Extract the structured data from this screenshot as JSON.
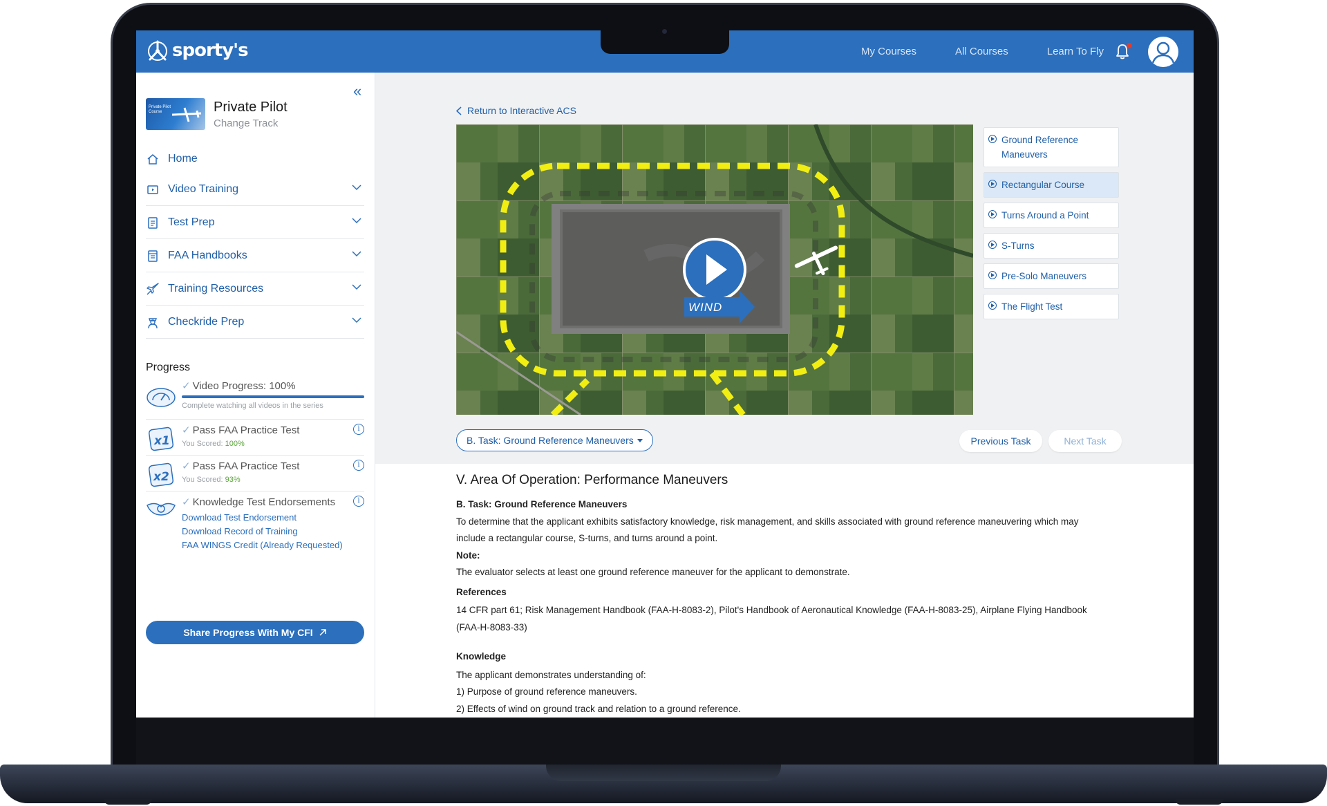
{
  "header": {
    "logo_text": "sporty's",
    "nav": [
      "My Courses",
      "All Courses",
      "Learn To Fly"
    ],
    "icons": [
      "bell-icon",
      "user-avatar-icon"
    ],
    "notification_dot_color": "#e23a2b"
  },
  "sidebar": {
    "course_thumb_text": "Private Pilot Course",
    "course_title": "Private Pilot",
    "course_subtitle": "Change Track",
    "items": [
      {
        "label": "Home",
        "icon": "home-icon"
      },
      {
        "label": "Video Training",
        "icon": "video-icon"
      },
      {
        "label": "Test Prep",
        "icon": "clipboard-icon"
      },
      {
        "label": "FAA Handbooks",
        "icon": "book-icon"
      },
      {
        "label": "Training Resources",
        "icon": "plane-icon"
      },
      {
        "label": "Checkride Prep",
        "icon": "pilot-icon"
      }
    ],
    "progress": {
      "heading": "Progress",
      "video": {
        "title": "Video Progress: 100%",
        "percent": 100,
        "sub": "Complete watching all videos in the series"
      },
      "test1": {
        "title": "Pass FAA Practice Test",
        "score_label": "You Scored:",
        "score": "100%"
      },
      "test2": {
        "title": "Pass FAA Practice Test",
        "score_label": "You Scored:",
        "score": "93%"
      },
      "endorsements": {
        "title": "Knowledge Test Endorsements",
        "links": [
          "Download Test Endorsement",
          "Download Record of Training",
          "FAA WINGS Credit (Already Requested)"
        ]
      }
    },
    "share_button": "Share Progress With My CFI"
  },
  "main": {
    "back_link": "Return to Interactive ACS",
    "video_label": "WIND",
    "tasks": [
      {
        "label": "Ground Reference Maneuvers",
        "active": false
      },
      {
        "label": "Rectangular Course",
        "active": true
      },
      {
        "label": "Turns Around a Point",
        "active": false
      },
      {
        "label": "S-Turns",
        "active": false
      },
      {
        "label": "Pre-Solo Maneuvers",
        "active": false
      },
      {
        "label": "The Flight Test",
        "active": false
      }
    ],
    "task_dropdown": "B. Task: Ground Reference Maneuvers",
    "prev": "Previous Task",
    "next": "Next Task",
    "area_title": "V. Area Of Operation: Performance Maneuvers",
    "task_heading": "B. Task: Ground Reference Maneuvers",
    "task_text": "To determine that the applicant exhibits satisfactory knowledge, risk management, and skills associated with ground reference maneuvering which may include a rectangular course, S-turns, and turns around a point.",
    "note_heading": "Note:",
    "note_text": "The evaluator selects at least one ground reference maneuver for the applicant to demonstrate.",
    "references_heading": "References",
    "references_text": "14 CFR part 61; Risk Management Handbook (FAA-H-8083-2), Pilot's Handbook of Aeronautical Knowledge (FAA-H-8083-25), Airplane Flying Handbook (FAA-H-8083-33)",
    "knowledge_heading": "Knowledge",
    "knowledge_intro": "The applicant demonstrates understanding of:",
    "knowledge_items": [
      "1) Purpose of ground reference maneuvers.",
      "2) Effects of wind on ground track and relation to a ground reference."
    ]
  },
  "colors": {
    "brand": "#2b6fbd",
    "link": "#1f5fa8",
    "success": "#5aa83a",
    "path": "#f2ee12"
  }
}
